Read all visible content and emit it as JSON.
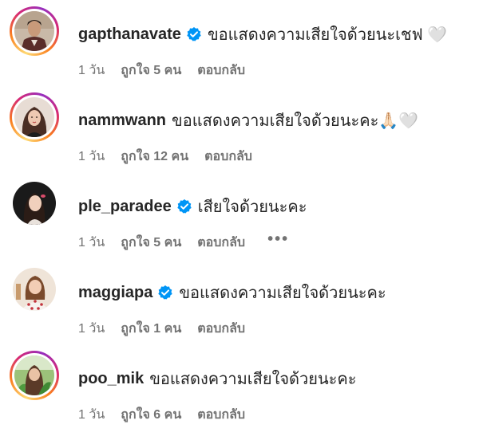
{
  "comments": [
    {
      "username": "gapthanavate",
      "verified": true,
      "text": "ขอแสดงความเสียใจด้วยนะเชฟ 🤍",
      "time": "1 วัน",
      "likes": "ถูกใจ 5 คน",
      "reply": "ตอบกลับ",
      "avatar_icon": "man-in-suit-avatar",
      "story_ring": true
    },
    {
      "username": "nammwann",
      "verified": false,
      "text": "ขอแสดงความเสียใจด้วยนะคะ🙏🏻🤍",
      "time": "1 วัน",
      "likes": "ถูกใจ 12 คน",
      "reply": "ตอบกลับ",
      "avatar_icon": "woman-portrait-avatar",
      "story_ring": true
    },
    {
      "username": "ple_paradee",
      "verified": true,
      "text": "เสียใจด้วยนะคะ",
      "time": "1 วัน",
      "likes": "ถูกใจ 5 คน",
      "reply": "ตอบกลับ",
      "more": "•••",
      "avatar_icon": "woman-dark-background-avatar",
      "story_ring": false
    },
    {
      "username": "maggiapa",
      "verified": true,
      "text": "ขอแสดงความเสียใจด้วยนะคะ",
      "time": "1 วัน",
      "likes": "ถูกใจ 1 คน",
      "reply": "ตอบกลับ",
      "avatar_icon": "woman-polka-dot-avatar",
      "story_ring": false
    },
    {
      "username": "poo_mik",
      "verified": false,
      "text": "ขอแสดงความเสียใจด้วยนะคะ",
      "time": "1 วัน",
      "likes": "ถูกใจ 6 คน",
      "reply": "ตอบกลับ",
      "avatar_icon": "woman-green-plant-avatar",
      "story_ring": true
    }
  ],
  "colors": {
    "text": "#262626",
    "meta": "#737373",
    "verified_badge": "#0095f6"
  }
}
